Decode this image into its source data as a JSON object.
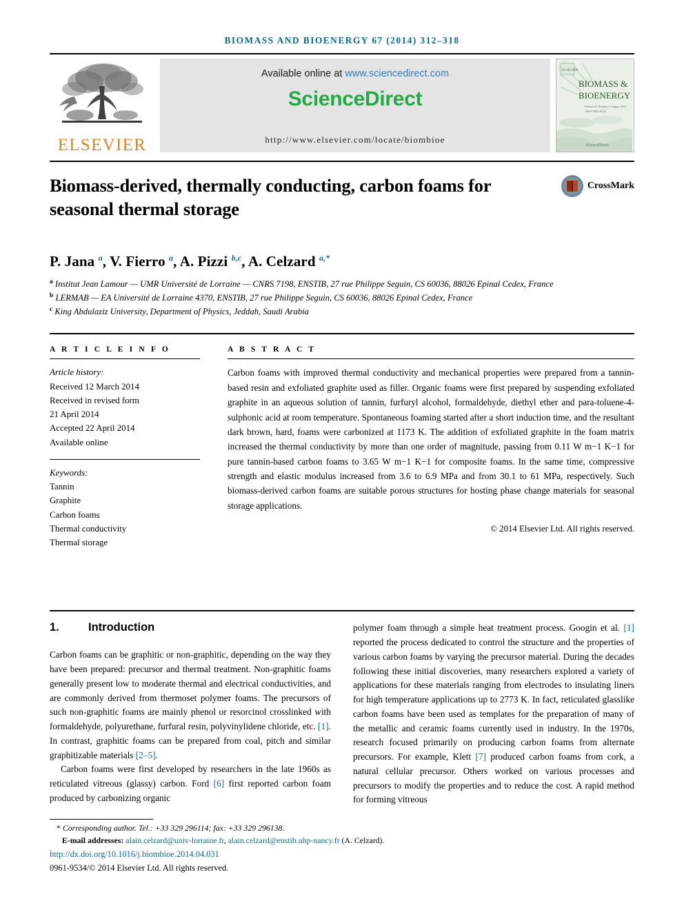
{
  "running_head": "BIOMASS AND BIOENERGY 67 (2014) 312–318",
  "masthead": {
    "publisher_name": "ELSEVIER",
    "available_prefix": "Available online at ",
    "sciencedirect_url": "www.sciencedirect.com",
    "sciencedirect_logo": "ScienceDirect",
    "journal_homepage": "http://www.elsevier.com/locate/biombioe",
    "cover": {
      "line1": "BIOMASS &",
      "line2": "BIOENERGY",
      "subtitle1": "Volume 67  Number 1  August 2014",
      "subtitle2": "ISSN 0961-9534",
      "footer_brand": "ScienceDirect"
    }
  },
  "article": {
    "title": "Biomass-derived, thermally conducting, carbon foams for seasonal thermal storage",
    "crossmark_label": "CrossMark",
    "authors_html": "P. Jana <sup>a</sup>, V. Fierro <sup>a</sup>, A. Pizzi <sup>b,c</sup>, A. Celzard <sup>a,*</sup>",
    "affiliations": [
      "a Institut Jean Lamour — UMR Université de Lorraine — CNRS 7198, ENSTIB, 27 rue Philippe Seguin, CS 60036, 88026 Epinal Cedex, France",
      "b LERMAB — EA Université de Lorraine 4370, ENSTIB, 27 rue Philippe Seguin, CS 60036, 88026 Epinal Cedex, France",
      "c King Abdulaziz University, Department of Physics, Jeddah, Saudi Arabia"
    ],
    "affiliation_marks": [
      "a",
      "b",
      "c"
    ],
    "affiliation_texts": [
      "Institut Jean Lamour — UMR Université de Lorraine — CNRS 7198, ENSTIB, 27 rue Philippe Seguin, CS 60036, 88026 Epinal Cedex, France",
      "LERMAB — EA Université de Lorraine 4370, ENSTIB, 27 rue Philippe Seguin, CS 60036, 88026 Epinal Cedex, France",
      "King Abdulaziz University, Department of Physics, Jeddah, Saudi Arabia"
    ]
  },
  "article_info": {
    "heading": "A R T I C L E   I N F O",
    "history_label": "Article history:",
    "history": [
      "Received 12 March 2014",
      "Received in revised form",
      "21 April 2014",
      "Accepted 22 April 2014",
      "Available online"
    ],
    "keywords_label": "Keywords:",
    "keywords": [
      "Tannin",
      "Graphite",
      "Carbon foams",
      "Thermal conductivity",
      "Thermal storage"
    ]
  },
  "abstract": {
    "heading": "A B S T R A C T",
    "text": "Carbon foams with improved thermal conductivity and mechanical properties were prepared from a tannin-based resin and exfoliated graphite used as filler. Organic foams were first prepared by suspending exfoliated graphite in an aqueous solution of tannin, furfuryl alcohol, formaldehyde, diethyl ether and para-toluene-4-sulphonic acid at room temperature. Spontaneous foaming started after a short induction time, and the resultant dark brown, hard, foams were carbonized at 1173 K. The addition of exfoliated graphite in the foam matrix increased the thermal conductivity by more than one order of magnitude, passing from 0.11 W m−1 K−1 for pure tannin-based carbon foams to 3.65 W m−1 K−1 for composite foams. In the same time, compressive strength and elastic modulus increased from 3.6 to 6.9 MPa and from 30.1 to 61 MPa, respectively. Such biomass-derived carbon foams are suitable porous structures for hosting phase change materials for seasonal storage applications.",
    "copyright": "© 2014 Elsevier Ltd. All rights reserved."
  },
  "introduction": {
    "number": "1.",
    "title": "Introduction",
    "left_paragraph_1": "Carbon foams can be graphitic or non-graphitic, depending on the way they have been prepared: precursor and thermal treatment. Non-graphitic foams generally present low to moderate thermal and electrical conductivities, and are commonly derived from thermoset polymer foams. The precursors of such non-graphitic foams are mainly phenol or resorcinol crosslinked with formaldehyde, polyurethane, furfural resin, polyvinylidene chloride, etc. [1]. In contrast, graphitic foams can be prepared from coal, pitch and similar graphitizable materials [2–5].",
    "left_paragraph_2": "Carbon foams were first developed by researchers in the late 1960s as reticulated vitreous (glassy) carbon. Ford [6] first reported carbon foam produced by carbonizing organic",
    "right_paragraph_1": "polymer foam through a simple heat treatment process. Googin et al. [1] reported the process dedicated to control the structure and the properties of various carbon foams by varying the precursor material. During the decades following these initial discoveries, many researchers explored a variety of applications for these materials ranging from electrodes to insulating liners for high temperature applications up to 2773 K. In fact, reticulated glasslike carbon foams have been used as templates for the preparation of many of the metallic and ceramic foams currently used in industry. In the 1970s, research focused primarily on producing carbon foams from alternate precursors. For example, Klett [7] produced carbon foams from cork, a natural cellular precursor. Others worked on various processes and precursors to modify the properties and to reduce the cost. A rapid method for forming vitreous"
  },
  "footnote": {
    "corresponding": "Corresponding author. Tel.: +33 329 296114; fax: +33 329 296138.",
    "email_label": "E-mail addresses:",
    "email_1": "alain.celzard@univ-lorraine.fr",
    "email_2": "alain.celzard@enstib.uhp-nancy.fr",
    "email_suffix": "(A. Celzard).",
    "doi": "http://dx.doi.org/10.1016/j.biombioe.2014.04.031",
    "issn": "0961-9534/© 2014 Elsevier Ltd. All rights reserved."
  },
  "colors": {
    "journal_teal": "#0b6a94",
    "elsevier_orange": "#ec8013",
    "sciencedirect_green": "#22aa44",
    "link_blue": "#2f7fc1",
    "banner_gray": "#e4e4e4"
  }
}
